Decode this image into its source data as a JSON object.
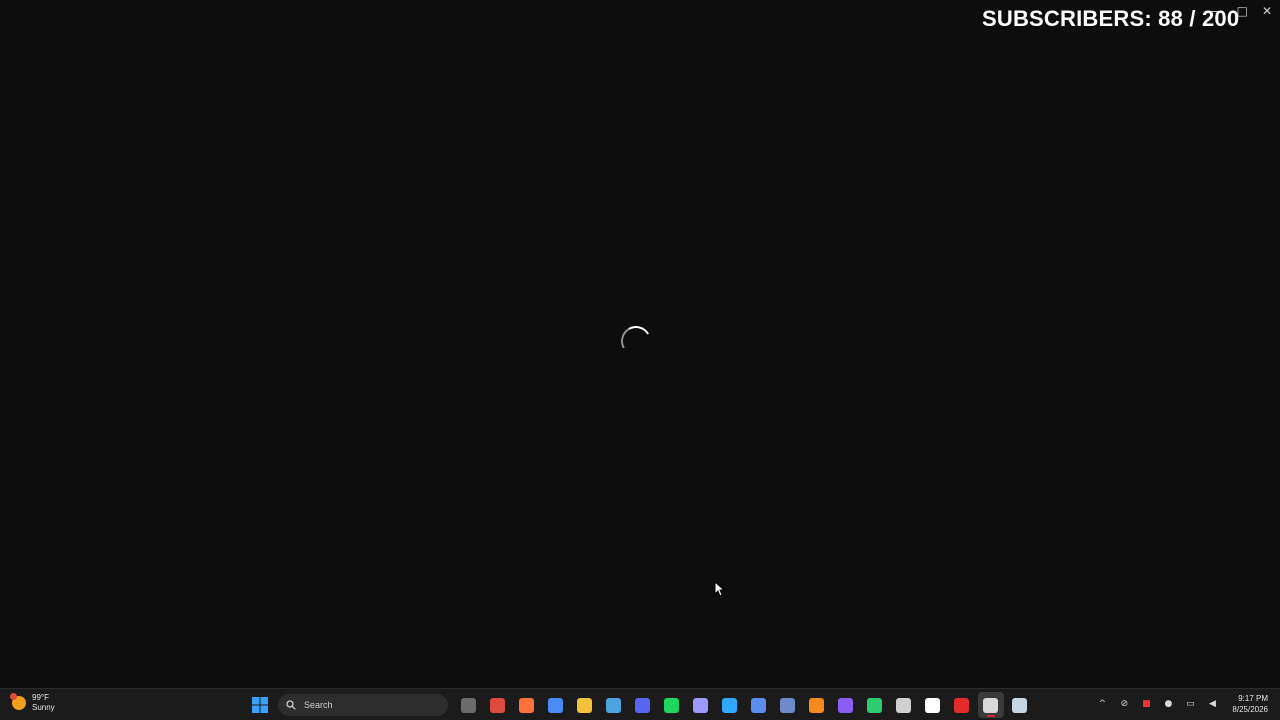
{
  "overlay": {
    "counter_text": "SUBSCRIBERS: 88 / 200"
  },
  "window_controls": {
    "minimize": "—",
    "maximize": "□",
    "close": "✕"
  },
  "weather": {
    "temperature": "99°F",
    "condition": "Sunny"
  },
  "taskbar": {
    "search_label": "Search",
    "apps": [
      {
        "name": "task-view",
        "color": "#6b6b6b"
      },
      {
        "name": "chrome",
        "color": "#dd4b3e"
      },
      {
        "name": "firefox",
        "color": "#ff7139"
      },
      {
        "name": "browser",
        "color": "#4a8cf7"
      },
      {
        "name": "file-explorer",
        "color": "#f3c13a"
      },
      {
        "name": "steam-blue",
        "color": "#4da3e0"
      },
      {
        "name": "discord",
        "color": "#5865f2"
      },
      {
        "name": "spotify",
        "color": "#1ed760"
      },
      {
        "name": "premiere",
        "color": "#9999ff"
      },
      {
        "name": "photoshop",
        "color": "#31a8ff"
      },
      {
        "name": "app-s",
        "color": "#5b8def"
      },
      {
        "name": "app-sphere",
        "color": "#6c8cc9"
      },
      {
        "name": "fl-studio",
        "color": "#f48a1c"
      },
      {
        "name": "app-ring",
        "color": "#8b5cf6"
      },
      {
        "name": "app-green",
        "color": "#2ecc71"
      },
      {
        "name": "obs",
        "color": "#cfcfcf"
      },
      {
        "name": "app-bolt",
        "color": "#ffffff"
      },
      {
        "name": "app-red",
        "color": "#e32b2b"
      },
      {
        "name": "app-active",
        "color": "#d8d8d8"
      },
      {
        "name": "steam",
        "color": "#c7d5e0"
      }
    ]
  },
  "tray": {
    "chevron": "^",
    "time": "9:17 PM",
    "date": "8/25/2026"
  }
}
